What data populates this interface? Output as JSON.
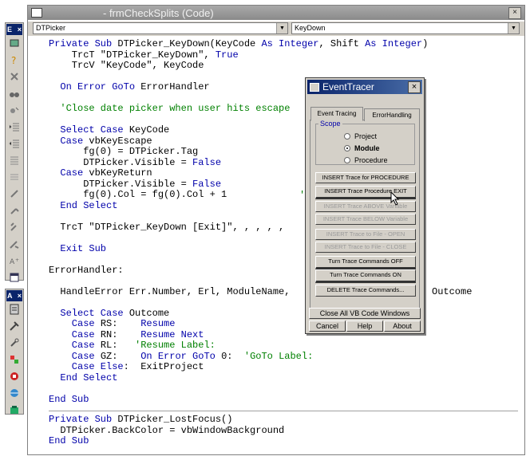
{
  "window_title": "- frmCheckSplits (Code)",
  "object_combo": "DTPicker",
  "procedure_combo": "KeyDown",
  "toolbar1": {
    "title": "E",
    "close": "×"
  },
  "toolbar2": {
    "title": "A",
    "close": "×"
  },
  "code_lines_1": [
    [
      [
        "k",
        "Private Sub "
      ],
      [
        "t",
        "DTPicker_KeyDown(KeyCode "
      ],
      [
        "k",
        "As Integer"
      ],
      [
        "t",
        ", Shift "
      ],
      [
        "k",
        "As Integer"
      ],
      [
        "t",
        ")"
      ]
    ],
    [
      [
        "t",
        "    TrcT \"DTPicker_KeyDown\", "
      ],
      [
        "k",
        "True"
      ]
    ],
    [
      [
        "t",
        "    TrcV \"KeyCode\", KeyCode"
      ]
    ],
    [
      [
        "t",
        ""
      ]
    ],
    [
      [
        "k",
        "  On Error GoTo "
      ],
      [
        "t",
        "ErrorHandler"
      ]
    ],
    [
      [
        "t",
        ""
      ]
    ],
    [
      [
        "c",
        "  'Close date picker when user hits escape"
      ]
    ],
    [
      [
        "t",
        ""
      ]
    ],
    [
      [
        "k",
        "  Select Case "
      ],
      [
        "t",
        "KeyCode"
      ]
    ],
    [
      [
        "k",
        "  Case "
      ],
      [
        "t",
        "vbKeyEscape"
      ]
    ],
    [
      [
        "t",
        "      fg(0) = DTPicker.Tag"
      ]
    ],
    [
      [
        "t",
        "      DTPicker.Visible = "
      ],
      [
        "k",
        "False"
      ]
    ],
    [
      [
        "k",
        "  Case "
      ],
      [
        "t",
        "vbKeyReturn"
      ]
    ],
    [
      [
        "t",
        "      DTPicker.Visible = "
      ],
      [
        "k",
        "False"
      ]
    ],
    [
      [
        "t",
        "      fg(0).Col = fg(0).Col + 1"
      ]
    ],
    [
      [
        "k",
        "  End Select"
      ]
    ],
    [
      [
        "t",
        ""
      ]
    ],
    [
      [
        "t",
        "  TrcT \"DTPicker_KeyDown [Exit]\", , , , ,"
      ]
    ],
    [
      [
        "t",
        ""
      ]
    ],
    [
      [
        "k",
        "  Exit Sub"
      ]
    ],
    [
      [
        "t",
        ""
      ]
    ],
    [
      [
        "t",
        "ErrorHandler:"
      ]
    ],
    [
      [
        "t",
        ""
      ]
    ],
    [
      [
        "t",
        "  HandleError Err.Number, Erl, ModuleName,"
      ]
    ],
    [
      [
        "t",
        ""
      ]
    ],
    [
      [
        "k",
        "  Select Case "
      ],
      [
        "t",
        "Outcome"
      ]
    ],
    [
      [
        "k",
        "    Case "
      ],
      [
        "t",
        "RS:    "
      ],
      [
        "k",
        "Resume"
      ]
    ],
    [
      [
        "k",
        "    Case "
      ],
      [
        "t",
        "RN:    "
      ],
      [
        "k",
        "Resume Next"
      ]
    ],
    [
      [
        "k",
        "    Case "
      ],
      [
        "t",
        "RL:   "
      ],
      [
        "c",
        "'Resume Label:"
      ]
    ],
    [
      [
        "k",
        "    Case "
      ],
      [
        "t",
        "GZ:    "
      ],
      [
        "k",
        "On Error GoTo "
      ],
      [
        "t",
        "0:  "
      ],
      [
        "c",
        "'GoTo Label:"
      ]
    ],
    [
      [
        "k",
        "    Case Else"
      ],
      [
        "t",
        ":  ExitProject"
      ]
    ],
    [
      [
        "k",
        "  End Select"
      ]
    ],
    [
      [
        "t",
        ""
      ]
    ],
    [
      [
        "k",
        "End Sub"
      ]
    ]
  ],
  "code_lines_2": [
    [
      [
        "k",
        "Private Sub "
      ],
      [
        "t",
        "DTPicker_LostFocus()"
      ]
    ],
    [
      [
        "t",
        "  DTPicker.BackColor = vbWindowBackground"
      ]
    ],
    [
      [
        "k",
        "End Sub"
      ]
    ]
  ],
  "stray_fragments": {
    "outcome": "Outcome",
    "quote": "'"
  },
  "event_tracer": {
    "title": "EventTracer",
    "close": "×",
    "tabs": [
      "Event Tracing",
      "ErrorHandling"
    ],
    "scope_label": "Scope",
    "scope_options": [
      "Project",
      "Module",
      "Procedure"
    ],
    "scope_selected": "Module",
    "buttons": [
      "INSERT Trace for PROCEDURE",
      "INSERT Trace  Procedure  EXIT",
      "INSERT  Trace  ABOVE  Variable",
      "INSERT  Trace  BELOW  Variable",
      "INSERT  Trace  to  File  -  OPEN",
      "INSERT  Trace  to  File  -  CLOSE",
      "Turn Trace Commands  OFF",
      "Turn Trace Commands  ON",
      "DELETE Trace Commands..."
    ],
    "close_all": "Close All VB Code Windows",
    "cancel": "Cancel",
    "help": "Help",
    "about": "About"
  }
}
